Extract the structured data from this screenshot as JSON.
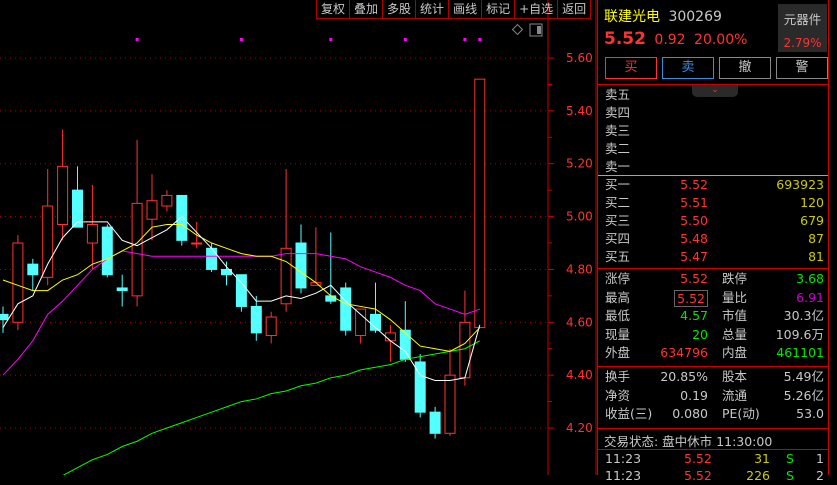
{
  "toolbar": [
    "复权",
    "叠加",
    "多股",
    "统计",
    "画线",
    "标记",
    "+自选",
    "返回"
  ],
  "stock": {
    "name": "联建光电",
    "code": "300269",
    "price": "5.52",
    "change": "0.92",
    "change_pct": "20.00%",
    "sector": "元器件",
    "sector_pct": "2.79%"
  },
  "buttons": {
    "buy": "买",
    "sell": "卖",
    "cancel": "撤",
    "alert": "警"
  },
  "sell_orders": [
    {
      "label": "卖五"
    },
    {
      "label": "卖四"
    },
    {
      "label": "卖三"
    },
    {
      "label": "卖二"
    },
    {
      "label": "卖一"
    }
  ],
  "buy_orders": [
    {
      "label": "买一",
      "price": "5.52",
      "vol": "693923"
    },
    {
      "label": "买二",
      "price": "5.51",
      "vol": "120"
    },
    {
      "label": "买三",
      "price": "5.50",
      "vol": "679"
    },
    {
      "label": "买四",
      "price": "5.48",
      "vol": "87"
    },
    {
      "label": "买五",
      "price": "5.47",
      "vol": "81"
    }
  ],
  "stats": [
    {
      "l1": "涨停",
      "v1": "5.52",
      "c1": "red",
      "l2": "跌停",
      "v2": "3.68",
      "c2": "green"
    },
    {
      "l1": "最高",
      "v1": "5.52",
      "c1": "red",
      "l2": "量比",
      "v2": "6.91",
      "c2": "purple"
    },
    {
      "l1": "最低",
      "v1": "4.57",
      "c1": "green",
      "l2": "市值",
      "v2": "30.3亿",
      "c2": "white"
    },
    {
      "l1": "现量",
      "v1": "20",
      "c1": "green",
      "l2": "总量",
      "v2": "109.6万",
      "c2": "white"
    },
    {
      "l1": "外盘",
      "v1": "634796",
      "c1": "red",
      "l2": "内盘",
      "v2": "461101",
      "c2": "green"
    }
  ],
  "fundamentals": [
    {
      "l1": "换手",
      "v1": "20.85%",
      "l2": "股本",
      "v2": "5.49亿"
    },
    {
      "l1": "净资",
      "v1": "0.19",
      "l2": "流通",
      "v2": "5.26亿"
    },
    {
      "l1": "收益(三)",
      "v1": "0.080",
      "l2": "PE(动)",
      "v2": "53.0"
    }
  ],
  "status": "交易状态: 盘中休市 11:30:00",
  "ticks": [
    {
      "time": "11:23",
      "price": "5.52",
      "vol": "31",
      "side": "S",
      "count": "1"
    },
    {
      "time": "11:23",
      "price": "5.52",
      "vol": "226",
      "side": "S",
      "count": "2"
    }
  ],
  "colors": {
    "up": "#ff3232",
    "down": "#54ffff",
    "ma5": "#ffffff",
    "ma10": "#ffff00",
    "ma20": "#ff00ff",
    "ma60": "#00ff00"
  },
  "chart_data": {
    "type": "candlestick",
    "y_ticks": [
      "5.60",
      "5.40",
      "5.20",
      "5.00",
      "4.80",
      "4.60",
      "4.40",
      "4.20"
    ],
    "ylim": [
      4.06,
      5.66
    ],
    "candles": [
      [
        4.63,
        4.66,
        4.56,
        4.61
      ],
      [
        4.6,
        4.93,
        4.57,
        4.9
      ],
      [
        4.82,
        4.84,
        4.72,
        4.78
      ],
      [
        4.77,
        5.18,
        4.74,
        5.04
      ],
      [
        4.97,
        5.33,
        4.91,
        5.19
      ],
      [
        5.1,
        5.19,
        4.96,
        4.96
      ],
      [
        4.9,
        5.12,
        4.8,
        4.97
      ],
      [
        4.96,
        4.97,
        4.77,
        4.78
      ],
      [
        4.73,
        4.78,
        4.66,
        4.72
      ],
      [
        4.7,
        5.29,
        4.66,
        5.05
      ],
      [
        4.99,
        5.16,
        4.91,
        5.06
      ],
      [
        5.04,
        5.1,
        5.02,
        5.08
      ],
      [
        5.08,
        5.08,
        4.89,
        4.91
      ],
      [
        4.9,
        4.98,
        4.88,
        4.9
      ],
      [
        4.88,
        4.9,
        4.79,
        4.8
      ],
      [
        4.8,
        4.83,
        4.74,
        4.78
      ],
      [
        4.78,
        4.78,
        4.64,
        4.66
      ],
      [
        4.66,
        4.7,
        4.53,
        4.56
      ],
      [
        4.55,
        4.64,
        4.52,
        4.62
      ],
      [
        4.67,
        5.18,
        4.64,
        4.88
      ],
      [
        4.9,
        4.97,
        4.71,
        4.73
      ],
      [
        4.74,
        4.96,
        4.74,
        4.75
      ],
      [
        4.7,
        4.94,
        4.67,
        4.68
      ],
      [
        4.73,
        4.75,
        4.55,
        4.57
      ],
      [
        4.55,
        4.65,
        4.52,
        4.65
      ],
      [
        4.63,
        4.75,
        4.56,
        4.57
      ],
      [
        4.53,
        4.59,
        4.45,
        4.56
      ],
      [
        4.57,
        4.68,
        4.45,
        4.46
      ],
      [
        4.45,
        4.48,
        4.24,
        4.26
      ],
      [
        4.26,
        4.28,
        4.16,
        4.18
      ],
      [
        4.18,
        4.5,
        4.17,
        4.4
      ],
      [
        4.39,
        4.72,
        4.36,
        4.6
      ],
      [
        4.58,
        5.52,
        4.58,
        5.52
      ]
    ],
    "ma5": [
      4.58,
      4.67,
      4.7,
      4.82,
      4.92,
      4.98,
      4.98,
      4.98,
      4.91,
      4.89,
      4.92,
      4.95,
      5.0,
      4.94,
      4.88,
      4.81,
      4.75,
      4.68,
      4.68,
      4.7,
      4.69,
      4.71,
      4.74,
      4.68,
      4.63,
      4.58,
      4.53,
      4.49,
      4.4,
      4.38,
      4.38,
      4.39,
      4.59
    ],
    "ma10": [
      4.76,
      4.74,
      4.72,
      4.72,
      4.76,
      4.78,
      4.82,
      4.84,
      4.87,
      4.9,
      4.96,
      4.97,
      4.97,
      4.93,
      4.9,
      4.88,
      4.86,
      4.85,
      4.85,
      4.83,
      4.79,
      4.75,
      4.7,
      4.67,
      4.66,
      4.65,
      4.61,
      4.56,
      4.51,
      4.5,
      4.49,
      4.52,
      4.58
    ],
    "ma20": [
      4.4,
      4.46,
      4.53,
      4.63,
      4.68,
      4.74,
      4.8,
      4.84,
      4.87,
      4.86,
      4.85,
      4.85,
      4.85,
      4.85,
      4.85,
      4.85,
      4.85,
      4.85,
      4.85,
      4.86,
      4.86,
      4.86,
      4.85,
      4.84,
      4.81,
      4.79,
      4.77,
      4.74,
      4.72,
      4.67,
      4.65,
      4.63,
      4.65
    ],
    "ma60": [
      null,
      null,
      null,
      null,
      4.02,
      4.05,
      4.08,
      4.1,
      4.13,
      4.15,
      4.18,
      4.2,
      4.22,
      4.24,
      4.26,
      4.28,
      4.3,
      4.31,
      4.33,
      4.34,
      4.36,
      4.37,
      4.39,
      4.4,
      4.42,
      4.43,
      4.44,
      4.46,
      4.47,
      4.48,
      4.49,
      4.5,
      4.53
    ],
    "marker_candles": [
      9,
      16,
      22,
      27,
      31,
      32
    ]
  }
}
